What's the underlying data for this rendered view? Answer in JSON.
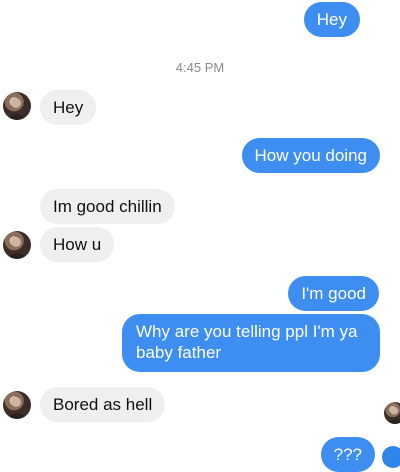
{
  "timestamp": "4:45 PM",
  "messages": [
    {
      "from": "me",
      "text": "Hey"
    },
    {
      "from": "them",
      "text": "Hey"
    },
    {
      "from": "me",
      "text": "How you doing"
    },
    {
      "from": "them",
      "text": "Im good chillin"
    },
    {
      "from": "them",
      "text": "How u"
    },
    {
      "from": "me",
      "text": "I'm good"
    },
    {
      "from": "me",
      "text": "Why are you telling ppl I'm ya baby father"
    },
    {
      "from": "them",
      "text": "Bored as hell"
    },
    {
      "from": "me",
      "text": "???"
    }
  ],
  "colors": {
    "outgoing_bubble": "#3d8ef0",
    "incoming_bubble": "#eeeff1",
    "timestamp_text": "#8a8a8e"
  },
  "icons": {
    "contact_avatar": "contact-avatar-icon",
    "read_receipt": "read-receipt-avatar-icon"
  }
}
